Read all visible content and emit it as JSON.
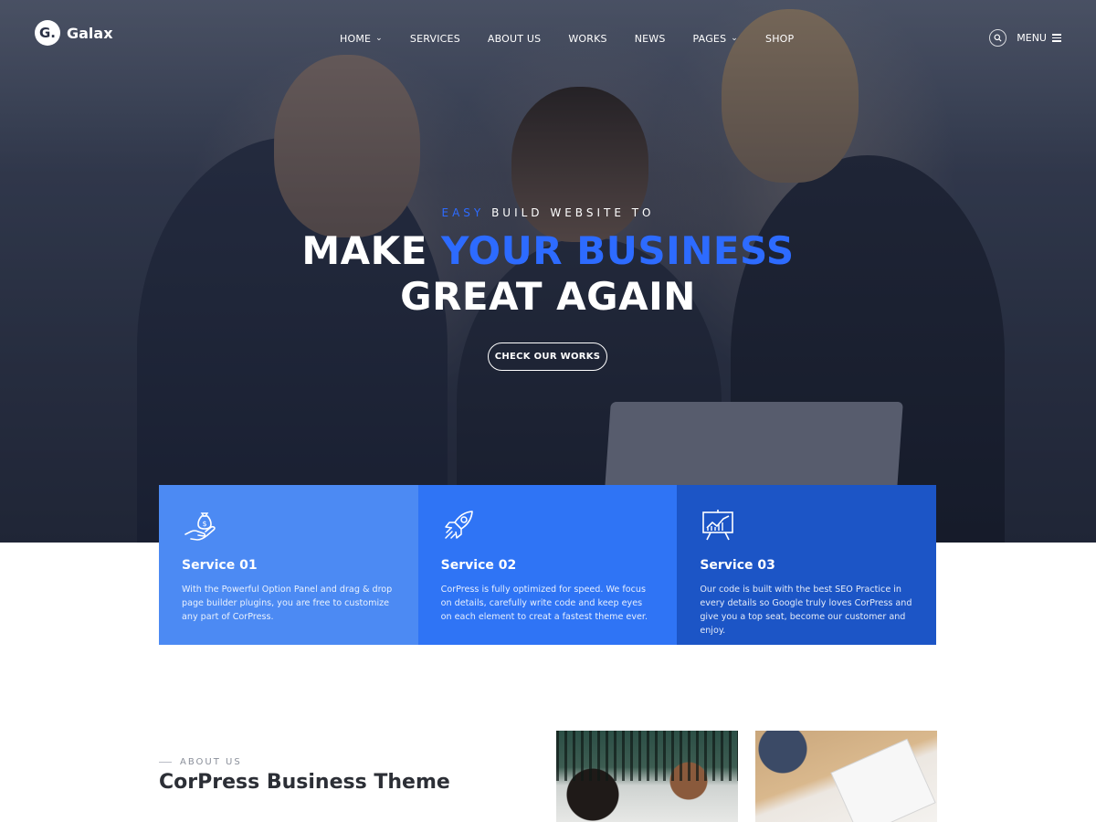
{
  "brand": {
    "logo_mark": "G.",
    "name": "Galax"
  },
  "nav": {
    "items": [
      {
        "label": "HOME",
        "has_dropdown": true
      },
      {
        "label": "SERVICES",
        "has_dropdown": false
      },
      {
        "label": "ABOUT US",
        "has_dropdown": false
      },
      {
        "label": "WORKS",
        "has_dropdown": false
      },
      {
        "label": "NEWS",
        "has_dropdown": false
      },
      {
        "label": "PAGES",
        "has_dropdown": true
      },
      {
        "label": "SHOP",
        "has_dropdown": false
      }
    ],
    "dropdown_icon": "chevron-down-icon",
    "search_icon": "search-icon",
    "menu_label": "MENU",
    "menu_icon": "hamburger-icon"
  },
  "hero": {
    "eyebrow_accent": "EASY",
    "eyebrow_rest": " BUILD WEBSITE TO",
    "headline_line1_prefix": "MAKE ",
    "headline_line1_accent": "YOUR BUSINESS",
    "headline_line2": "GREAT AGAIN",
    "cta_label": "CHECK OUR WORKS"
  },
  "services": [
    {
      "icon": "money-bag-hand-icon",
      "title": "Service 01",
      "description": "With the Powerful Option Panel and drag & drop page builder plugins, you are free to customize any part of CorPress."
    },
    {
      "icon": "rocket-icon",
      "title": "Service 02",
      "description": "CorPress is fully optimized for speed. We focus on details, carefully write code and keep eyes on each element to creat a fastest theme ever."
    },
    {
      "icon": "presentation-chart-icon",
      "title": "Service 03",
      "description": "Our code is built with the best SEO Practice in every details so Google truly loves CorPress and give you a top seat, become our customer and enjoy."
    }
  ],
  "about": {
    "eyebrow": "ABOUT US",
    "title": "CorPress Business Theme"
  },
  "colors": {
    "accent": "#2d6bff",
    "service_1_bg": "#4c8af3",
    "service_2_bg": "#2f74f5",
    "service_3_bg": "#1c55c6",
    "heading_dark": "#2c2f36"
  }
}
